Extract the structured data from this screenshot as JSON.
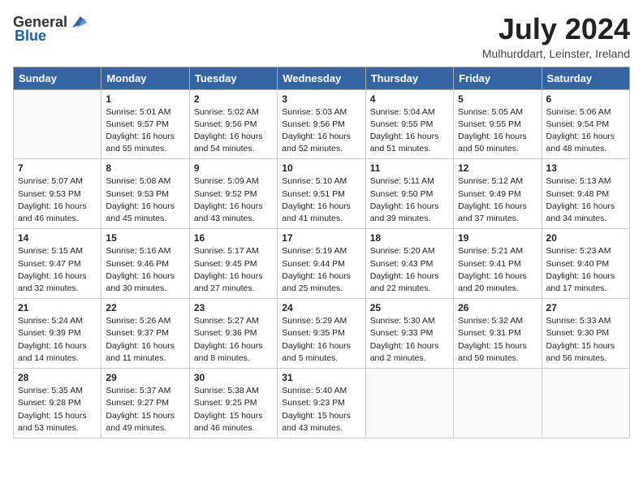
{
  "logo": {
    "general": "General",
    "blue": "Blue"
  },
  "title": "July 2024",
  "location": "Mulhurddart, Leinster, Ireland",
  "days_of_week": [
    "Sunday",
    "Monday",
    "Tuesday",
    "Wednesday",
    "Thursday",
    "Friday",
    "Saturday"
  ],
  "weeks": [
    [
      {
        "day": "",
        "info": ""
      },
      {
        "day": "1",
        "info": "Sunrise: 5:01 AM\nSunset: 9:57 PM\nDaylight: 16 hours\nand 55 minutes."
      },
      {
        "day": "2",
        "info": "Sunrise: 5:02 AM\nSunset: 9:56 PM\nDaylight: 16 hours\nand 54 minutes."
      },
      {
        "day": "3",
        "info": "Sunrise: 5:03 AM\nSunset: 9:56 PM\nDaylight: 16 hours\nand 52 minutes."
      },
      {
        "day": "4",
        "info": "Sunrise: 5:04 AM\nSunset: 9:55 PM\nDaylight: 16 hours\nand 51 minutes."
      },
      {
        "day": "5",
        "info": "Sunrise: 5:05 AM\nSunset: 9:55 PM\nDaylight: 16 hours\nand 50 minutes."
      },
      {
        "day": "6",
        "info": "Sunrise: 5:06 AM\nSunset: 9:54 PM\nDaylight: 16 hours\nand 48 minutes."
      }
    ],
    [
      {
        "day": "7",
        "info": "Sunrise: 5:07 AM\nSunset: 9:53 PM\nDaylight: 16 hours\nand 46 minutes."
      },
      {
        "day": "8",
        "info": "Sunrise: 5:08 AM\nSunset: 9:53 PM\nDaylight: 16 hours\nand 45 minutes."
      },
      {
        "day": "9",
        "info": "Sunrise: 5:09 AM\nSunset: 9:52 PM\nDaylight: 16 hours\nand 43 minutes."
      },
      {
        "day": "10",
        "info": "Sunrise: 5:10 AM\nSunset: 9:51 PM\nDaylight: 16 hours\nand 41 minutes."
      },
      {
        "day": "11",
        "info": "Sunrise: 5:11 AM\nSunset: 9:50 PM\nDaylight: 16 hours\nand 39 minutes."
      },
      {
        "day": "12",
        "info": "Sunrise: 5:12 AM\nSunset: 9:49 PM\nDaylight: 16 hours\nand 37 minutes."
      },
      {
        "day": "13",
        "info": "Sunrise: 5:13 AM\nSunset: 9:48 PM\nDaylight: 16 hours\nand 34 minutes."
      }
    ],
    [
      {
        "day": "14",
        "info": "Sunrise: 5:15 AM\nSunset: 9:47 PM\nDaylight: 16 hours\nand 32 minutes."
      },
      {
        "day": "15",
        "info": "Sunrise: 5:16 AM\nSunset: 9:46 PM\nDaylight: 16 hours\nand 30 minutes."
      },
      {
        "day": "16",
        "info": "Sunrise: 5:17 AM\nSunset: 9:45 PM\nDaylight: 16 hours\nand 27 minutes."
      },
      {
        "day": "17",
        "info": "Sunrise: 5:19 AM\nSunset: 9:44 PM\nDaylight: 16 hours\nand 25 minutes."
      },
      {
        "day": "18",
        "info": "Sunrise: 5:20 AM\nSunset: 9:43 PM\nDaylight: 16 hours\nand 22 minutes."
      },
      {
        "day": "19",
        "info": "Sunrise: 5:21 AM\nSunset: 9:41 PM\nDaylight: 16 hours\nand 20 minutes."
      },
      {
        "day": "20",
        "info": "Sunrise: 5:23 AM\nSunset: 9:40 PM\nDaylight: 16 hours\nand 17 minutes."
      }
    ],
    [
      {
        "day": "21",
        "info": "Sunrise: 5:24 AM\nSunset: 9:39 PM\nDaylight: 16 hours\nand 14 minutes."
      },
      {
        "day": "22",
        "info": "Sunrise: 5:26 AM\nSunset: 9:37 PM\nDaylight: 16 hours\nand 11 minutes."
      },
      {
        "day": "23",
        "info": "Sunrise: 5:27 AM\nSunset: 9:36 PM\nDaylight: 16 hours\nand 8 minutes."
      },
      {
        "day": "24",
        "info": "Sunrise: 5:29 AM\nSunset: 9:35 PM\nDaylight: 16 hours\nand 5 minutes."
      },
      {
        "day": "25",
        "info": "Sunrise: 5:30 AM\nSunset: 9:33 PM\nDaylight: 16 hours\nand 2 minutes."
      },
      {
        "day": "26",
        "info": "Sunrise: 5:32 AM\nSunset: 9:31 PM\nDaylight: 15 hours\nand 59 minutes."
      },
      {
        "day": "27",
        "info": "Sunrise: 5:33 AM\nSunset: 9:30 PM\nDaylight: 15 hours\nand 56 minutes."
      }
    ],
    [
      {
        "day": "28",
        "info": "Sunrise: 5:35 AM\nSunset: 9:28 PM\nDaylight: 15 hours\nand 53 minutes."
      },
      {
        "day": "29",
        "info": "Sunrise: 5:37 AM\nSunset: 9:27 PM\nDaylight: 15 hours\nand 49 minutes."
      },
      {
        "day": "30",
        "info": "Sunrise: 5:38 AM\nSunset: 9:25 PM\nDaylight: 15 hours\nand 46 minutes."
      },
      {
        "day": "31",
        "info": "Sunrise: 5:40 AM\nSunset: 9:23 PM\nDaylight: 15 hours\nand 43 minutes."
      },
      {
        "day": "",
        "info": ""
      },
      {
        "day": "",
        "info": ""
      },
      {
        "day": "",
        "info": ""
      }
    ]
  ]
}
